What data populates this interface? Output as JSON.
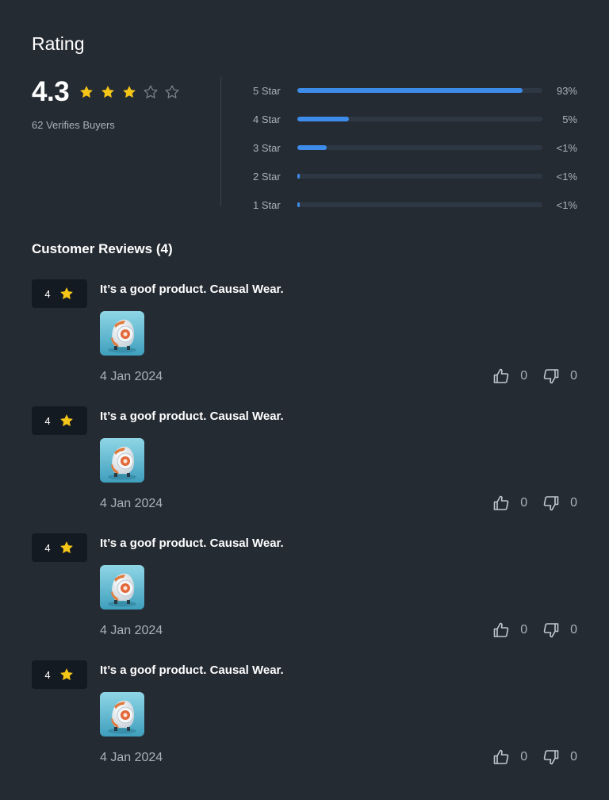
{
  "rating": {
    "title": "Rating",
    "average": "4.3",
    "star_fill": [
      1,
      1,
      1,
      0,
      0
    ],
    "verified_text": "62 Verifies Buyers",
    "star_color": "#f5c518"
  },
  "distribution": [
    {
      "label": "5 Star",
      "percent_text": "93%",
      "fill_fraction": 0.92
    },
    {
      "label": "4 Star",
      "percent_text": "5%",
      "fill_fraction": 0.21
    },
    {
      "label": "3 Star",
      "percent_text": "<1%",
      "fill_fraction": 0.12
    },
    {
      "label": "2 Star",
      "percent_text": "<1%",
      "fill_fraction": 0.01
    },
    {
      "label": "1 Star",
      "percent_text": "<1%",
      "fill_fraction": 0.01
    }
  ],
  "reviews_section": {
    "title": "Customer Reviews (4)",
    "reviews": [
      {
        "rating": "4",
        "text": "It’s a goof product. Causal Wear.",
        "date": "4 Jan 2024",
        "likes": "0",
        "dislikes": "0",
        "image_icon": "product-thumbnail"
      },
      {
        "rating": "4",
        "text": "It’s a goof product. Causal Wear.",
        "date": "4 Jan 2024",
        "likes": "0",
        "dislikes": "0",
        "image_icon": "product-thumbnail"
      },
      {
        "rating": "4",
        "text": "It’s a goof product. Causal Wear.",
        "date": "4 Jan 2024",
        "likes": "0",
        "dislikes": "0",
        "image_icon": "product-thumbnail"
      },
      {
        "rating": "4",
        "text": "It’s a goof product. Causal Wear.",
        "date": "4 Jan 2024",
        "likes": "0",
        "dislikes": "0",
        "image_icon": "product-thumbnail"
      }
    ]
  },
  "colors": {
    "background": "#252b33",
    "bar_fill": "#3d8cea",
    "bar_track": "#2e3744",
    "badge_bg": "#141a22",
    "muted_text": "#aab1bb"
  }
}
